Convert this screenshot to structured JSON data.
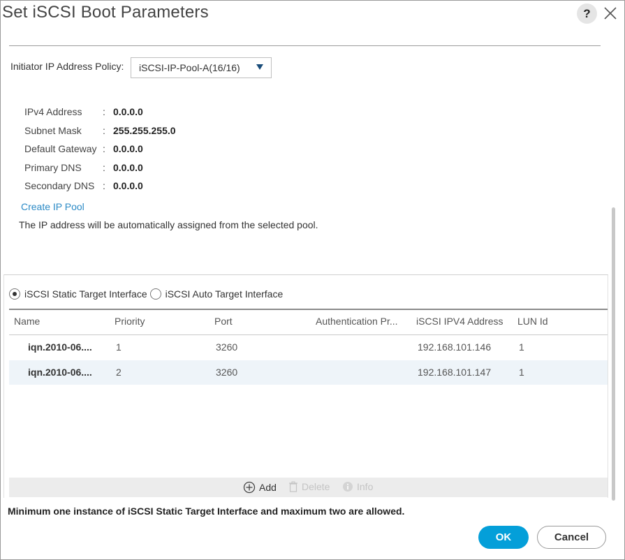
{
  "dialog": {
    "title": "Set iSCSI Boot Parameters",
    "help_label": "?",
    "close_icon": "close-icon"
  },
  "policy": {
    "label": "Initiator IP Address Policy:",
    "selected": "iSCSI-IP-Pool-A(16/16)"
  },
  "ip_info": [
    {
      "label": "IPv4 Address",
      "colon": ":",
      "value": "0.0.0.0"
    },
    {
      "label": "Subnet Mask",
      "colon": ":",
      "value": "255.255.255.0"
    },
    {
      "label": "Default Gateway",
      "colon": ":",
      "value": "0.0.0.0"
    },
    {
      "label": "Primary DNS",
      "colon": ":",
      "value": "0.0.0.0"
    },
    {
      "label": "Secondary DNS",
      "colon": ":",
      "value": "0.0.0.0"
    }
  ],
  "create_pool_link": "Create IP Pool",
  "auto_note": "The IP address will be automatically assigned from the selected pool.",
  "target_interface": {
    "static_label": "iSCSI Static Target Interface",
    "auto_label": "iSCSI Auto Target Interface",
    "selected": "static"
  },
  "table": {
    "columns": [
      "Name",
      "Priority",
      "Port",
      "Authentication Pr...",
      "iSCSI IPV4 Address",
      "LUN Id"
    ],
    "rows": [
      {
        "name": "iqn.2010-06....",
        "priority": "1",
        "port": "3260",
        "auth": "",
        "ipv4": "192.168.101.146",
        "lun": "1"
      },
      {
        "name": "iqn.2010-06....",
        "priority": "2",
        "port": "3260",
        "auth": "",
        "ipv4": "192.168.101.147",
        "lun": "1"
      }
    ]
  },
  "toolbar": {
    "add": "Add",
    "delete": "Delete",
    "info": "Info"
  },
  "note": "Minimum one instance of iSCSI Static Target Interface and maximum two are allowed.",
  "buttons": {
    "ok": "OK",
    "cancel": "Cancel"
  },
  "colors": {
    "accent": "#049fd9",
    "link": "#2b8ac6",
    "row_highlight": "#eef4f9"
  }
}
